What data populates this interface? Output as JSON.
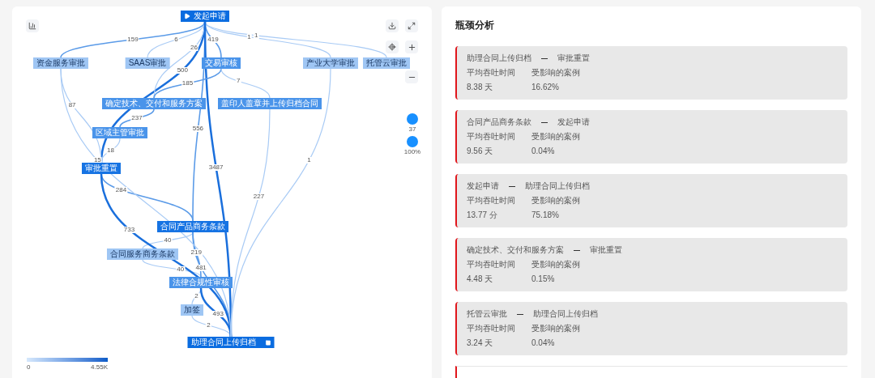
{
  "process_map": {
    "nodes": [
      {
        "label": "发起申请",
        "kind": "start"
      },
      {
        "label": "资金服务审批",
        "kind": "light"
      },
      {
        "label": "SAAS审批",
        "kind": "light"
      },
      {
        "label": "交易审核",
        "kind": "mid"
      },
      {
        "label": "产业大学审批",
        "kind": "light"
      },
      {
        "label": "托管云审批",
        "kind": "light"
      },
      {
        "label": "确定技术、交付和服务方案",
        "kind": "mid"
      },
      {
        "label": "盖印人盖章并上传归档合同",
        "kind": "mid"
      },
      {
        "label": "区域主管审批",
        "kind": "mid"
      },
      {
        "label": "审批重置",
        "kind": "dark"
      },
      {
        "label": "合同产品商务条款",
        "kind": "dark"
      },
      {
        "label": "合同服务商务条款",
        "kind": "light"
      },
      {
        "label": "法律合规性审核",
        "kind": "mid"
      },
      {
        "label": "加签",
        "kind": "light"
      },
      {
        "label": "助理合同上传归档",
        "kind": "end"
      }
    ],
    "edges": [
      {
        "count": "159",
        "kind": "normal"
      },
      {
        "count": "500",
        "kind": "strong"
      },
      {
        "count": "6",
        "kind": "light"
      },
      {
        "count": "419",
        "kind": "normal"
      },
      {
        "count": "1",
        "kind": "light"
      },
      {
        "count": "1",
        "kind": "light"
      },
      {
        "count": "26",
        "kind": "light"
      },
      {
        "count": "556",
        "kind": "normal"
      },
      {
        "count": "3487",
        "kind": "strong"
      },
      {
        "count": "185",
        "kind": "normal"
      },
      {
        "count": "7",
        "kind": "light"
      },
      {
        "count": "237",
        "kind": "normal"
      },
      {
        "count": "87",
        "kind": "light"
      },
      {
        "count": "18",
        "kind": "light"
      },
      {
        "count": "284",
        "kind": "normal"
      },
      {
        "count": "40",
        "kind": "light"
      },
      {
        "count": "40",
        "kind": "light"
      },
      {
        "count": "219",
        "kind": "normal"
      },
      {
        "count": "2",
        "kind": "light"
      },
      {
        "count": "2",
        "kind": "light"
      },
      {
        "count": "493",
        "kind": "strong"
      },
      {
        "count": "481",
        "kind": "normal"
      },
      {
        "count": "733",
        "kind": "strong"
      },
      {
        "count": "227",
        "kind": "light"
      },
      {
        "count": "1",
        "kind": "light"
      },
      {
        "count": "15",
        "kind": "light"
      }
    ],
    "sliders": [
      {
        "reading": "37"
      },
      {
        "reading": "100%"
      }
    ],
    "legend": {
      "min": "0",
      "max": "4.55K"
    }
  },
  "bottleneck_panel": {
    "title": "瓶颈分析",
    "items": [
      {
        "from": "助理合同上传归档",
        "to": "审批重置",
        "time_label": "平均吞吐时间",
        "cases_label": "受影响的案例",
        "time": "8.38 天",
        "cases": "16.62%"
      },
      {
        "from": "合同产品商务条款",
        "to": "发起申请",
        "time_label": "平均吞吐时间",
        "cases_label": "受影响的案例",
        "time": "9.56 天",
        "cases": "0.04%"
      },
      {
        "from": "发起申请",
        "to": "助理合同上传归档",
        "time_label": "平均吞吐时间",
        "cases_label": "受影响的案例",
        "time": "13.77 分",
        "cases": "75.18%"
      },
      {
        "from": "确定技术、交付和服务方案",
        "to": "审批重置",
        "time_label": "平均吞吐时间",
        "cases_label": "受影响的案例",
        "time": "4.48 天",
        "cases": "0.15%"
      },
      {
        "from": "托管云审批",
        "to": "助理合同上传归档",
        "time_label": "平均吞吐时间",
        "cases_label": "受影响的案例",
        "time": "3.24 天",
        "cases": "0.04%"
      }
    ]
  }
}
